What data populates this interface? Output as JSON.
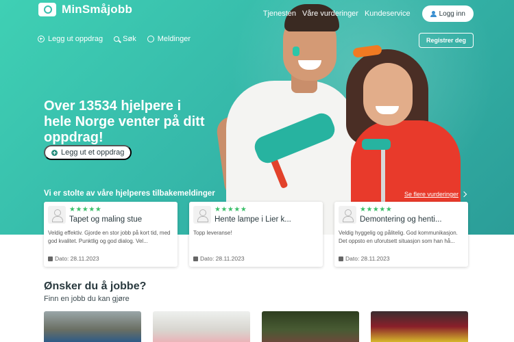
{
  "brand": {
    "name": "MinSmåjobb"
  },
  "topnav": {
    "links": [
      "Tjenesten",
      "Våre vurderinger",
      "Kundeservice"
    ],
    "login_label": "Logg inn"
  },
  "subnav": {
    "post": "Legg ut oppdrag",
    "search": "Søk",
    "messages": "Meldinger",
    "register": "Registrer deg"
  },
  "hero": {
    "headline": "Over 13534 hjelpere i hele Norge venter på ditt oppdrag!",
    "cta": "Legg ut et oppdrag"
  },
  "reviews": {
    "title": "Vi er stolte av våre hjelperes tilbakemeldinger",
    "more": "Se flere vurderinger",
    "items": [
      {
        "stars": "★★★★★",
        "title": "Tapet og maling stue",
        "text": "Veldig effektiv. Gjorde en stor jobb på kort tid, med god kvalitet. Punktlig og god dialog. Vel...",
        "date": "Dato: 28.11.2023"
      },
      {
        "stars": "★★★★★",
        "title": "Hente lampe i Lier k...",
        "text": "Topp leveranse!",
        "date": "Dato: 28.11.2023"
      },
      {
        "stars": "★★★★★",
        "title": "Demontering og henti...",
        "text": "Veldig hyggelig og pålitelig. God kommunikasjon. Det oppsto en uforutsett situasjon som han hå...",
        "date": "Dato: 28.11.2023"
      }
    ]
  },
  "jobs_section": {
    "title": "Ønsker du å jobbe?",
    "subtitle": "Finn en jobb du kan gjøre"
  },
  "colors": {
    "brand": "#38bfae",
    "star": "#3bbf6a"
  }
}
